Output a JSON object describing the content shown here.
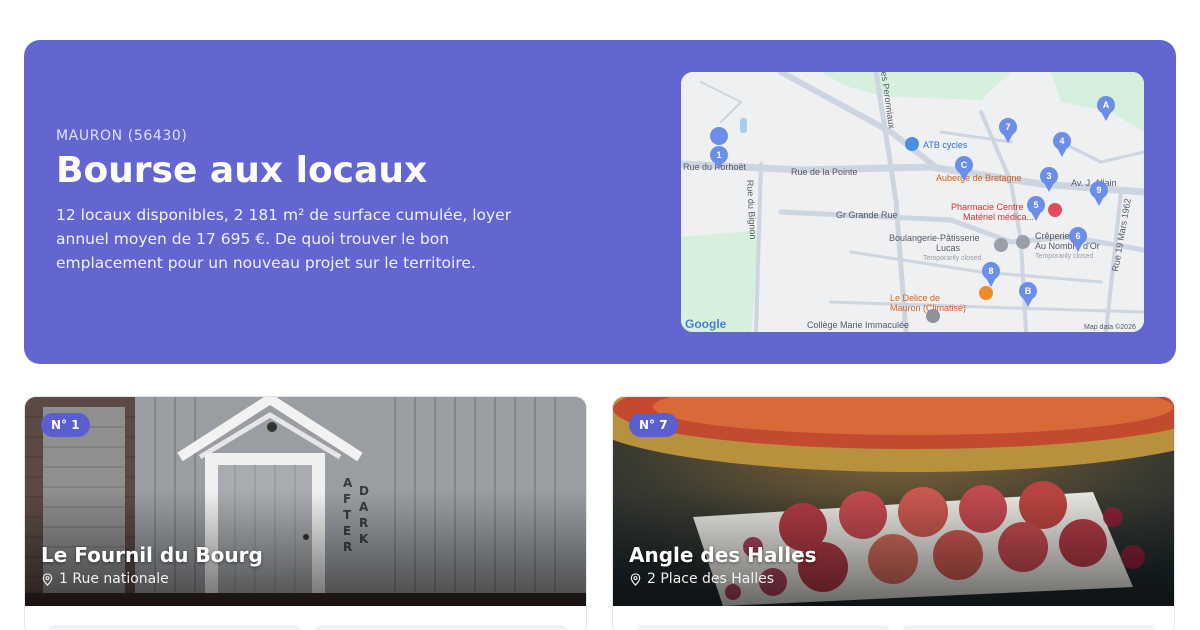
{
  "hero": {
    "city": "MAURON (56430)",
    "title": "Bourse aux locaux",
    "description": "12 locaux disponibles, 2 181 m² de surface cumulée, loyer annuel moyen de 17 695 €. De quoi trouver le bon emplacement pour un nouveau projet sur le territoire."
  },
  "map": {
    "streets": [
      "Rue du Porhoët",
      "Rue de la Pointe",
      "Gr Grande Rue",
      "Rue du Bignon",
      "es Peronniaux",
      "Av. J. Allain",
      "Rue 19 Mars 1962"
    ],
    "places": [
      "ATB cycles",
      "Auberge de Bretagne",
      "Pharmacie Centre",
      "Matériel médica...",
      "Crêperie de",
      "Au Nombre d'Or",
      "Temporarily closed",
      "Boulangerie-Pâtisserie",
      "Lucas",
      "Temporarily closed",
      "Le Delice de",
      "Mauron (Climatisé)",
      "Collège Marie Immaculée"
    ],
    "markers": [
      "1",
      "7",
      "4",
      "3",
      "C",
      "5",
      "A",
      "9",
      "6",
      "8",
      "B"
    ],
    "logo": "Google",
    "attribution": "Map data ©2026"
  },
  "listings": [
    {
      "badge": "N° 1",
      "title": "Le Fournil du Bourg",
      "address": "1 Rue nationale"
    },
    {
      "badge": "N° 7",
      "title": "Angle des Halles",
      "address": "2 Place des Halles"
    }
  ],
  "colors": {
    "accent": "#6366d1",
    "badge": "#5a5fd0",
    "marker": "#6b8ee8"
  }
}
